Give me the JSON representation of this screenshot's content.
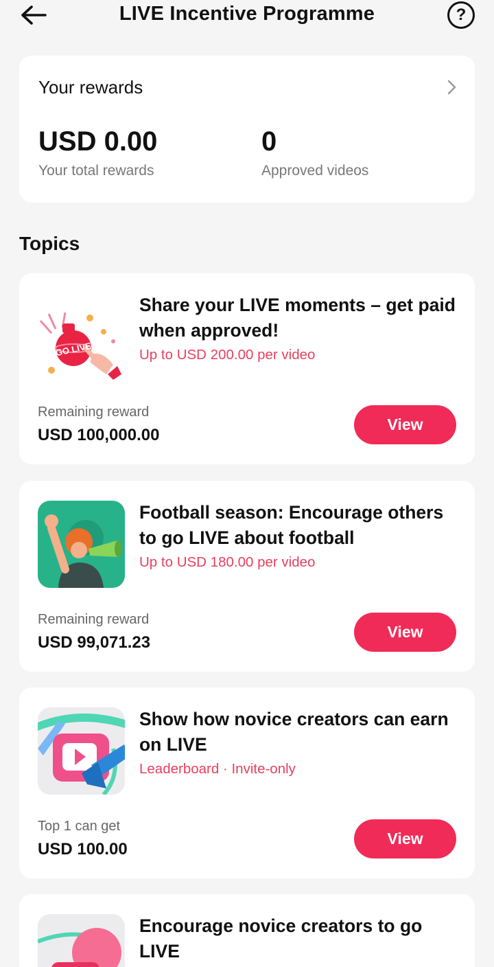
{
  "header": {
    "title": "LIVE Incentive Programme",
    "help_glyph": "?"
  },
  "rewards": {
    "title": "Your rewards",
    "total_value": "USD 0.00",
    "total_label": "Your total rewards",
    "approved_value": "0",
    "approved_label": "Approved videos"
  },
  "topics_heading": "Topics",
  "thumb1_text": "GO LIVE",
  "topics": [
    {
      "title": "Share your LIVE moments – get paid when approved!",
      "subtitle": "Up to USD 200.00 per video",
      "reward_label": "Remaining reward",
      "reward_value": "USD 100,000.00",
      "button": "View"
    },
    {
      "title": "Football season: Encourage others to go LIVE about football",
      "subtitle": "Up to USD 180.00 per video",
      "reward_label": "Remaining reward",
      "reward_value": "USD 99,071.23",
      "button": "View"
    },
    {
      "title": "Show how novice creators can earn on LIVE",
      "subtitle": "Leaderboard · Invite-only",
      "reward_label": "Top 1 can get",
      "reward_value": "USD 100.00",
      "button": "View"
    },
    {
      "title": "Encourage novice creators to go LIVE"
    }
  ],
  "colors": {
    "accent": "#f02b57",
    "subtitle": "#e8405f",
    "background": "#f5f5f5"
  }
}
